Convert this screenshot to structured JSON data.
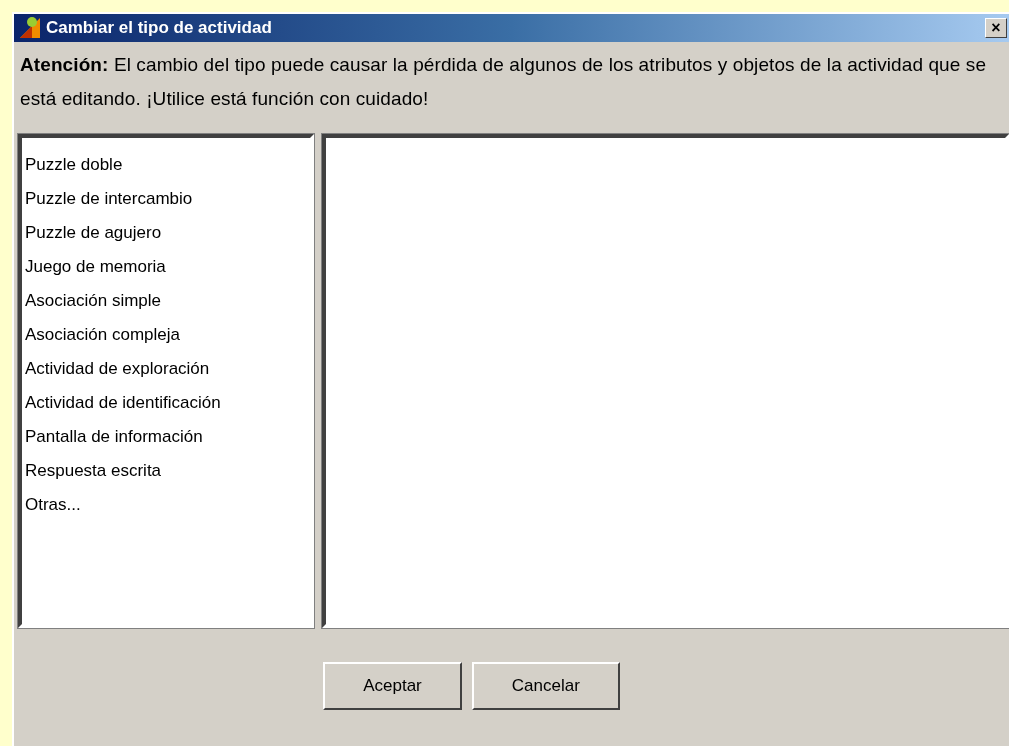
{
  "window": {
    "title": "Cambiar el tipo de actividad",
    "close": "×"
  },
  "warning": "**Atención:** El cambio del tipo puede causar la pérdida de algunos de los atributos y objetos de la actividad que se está editando. ¡Utilice está función con cuidado!",
  "activity_types": [
    "Puzzle doble",
    "Puzzle de intercambio",
    "Puzzle de agujero",
    "Juego de memoria",
    "Asociación simple",
    "Asociación compleja",
    "Actividad de exploración",
    "Actividad de identificación",
    "Pantalla de información",
    "Respuesta escrita",
    "Otras..."
  ],
  "buttons": [
    "Aceptar",
    "Cancelar"
  ]
}
